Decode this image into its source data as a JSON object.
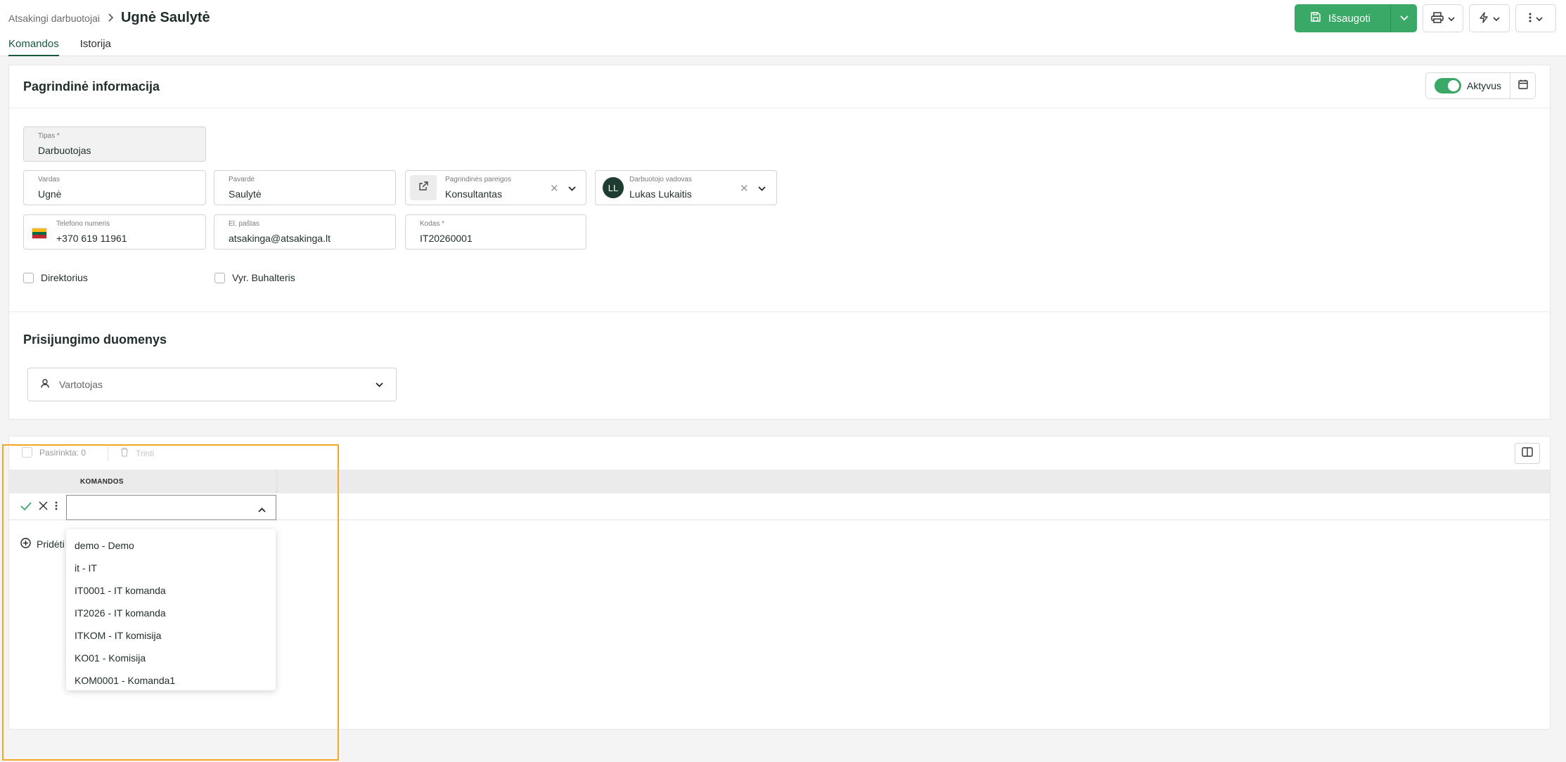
{
  "header": {
    "breadcrumb_parent": "Atsakingi darbuotojai",
    "title": "Ugnė Saulytė",
    "tabs": [
      {
        "label": "Komandos",
        "active": true
      },
      {
        "label": "Istorija",
        "active": false
      }
    ],
    "save_label": "Išsaugoti",
    "accent_color": "#3aa866"
  },
  "basic": {
    "section_title": "Pagrindinė informacija",
    "status_label": "Aktyvus",
    "status_active": true,
    "fields": {
      "type": {
        "label": "Tipas *",
        "value": "Darbuotojas"
      },
      "first_name": {
        "label": "Vardas",
        "value": "Ugnė"
      },
      "last_name": {
        "label": "Pavardė",
        "value": "Saulytė"
      },
      "position": {
        "label": "Pagrindinės pareigos",
        "value": "Konsultantas"
      },
      "manager": {
        "label": "Darbuotojo vadovas",
        "value": "Lukas Lukaitis",
        "initials": "LL"
      },
      "phone": {
        "label": "Telefono numeris",
        "value": "+370 619 11961"
      },
      "email": {
        "label": "El. paštas",
        "value": "atsakinga@atsakinga.lt"
      },
      "code": {
        "label": "Kodas *",
        "value": "IT20260001"
      }
    },
    "checkboxes": {
      "director": "Direktorius",
      "chief_accountant": "Vyr. Buhalteris"
    }
  },
  "login": {
    "section_title": "Prisijungimo duomenys",
    "user_placeholder": "Vartotojas"
  },
  "teams": {
    "selected_label": "Pasirinkta: 0",
    "delete_label": "Trinti",
    "column_header": "KOMANDOS",
    "add_label": "Pridėti",
    "options": [
      "demo - Demo",
      "it - IT",
      "IT0001 - IT komanda",
      "IT2026 - IT komanda",
      "ITKOM - IT komisija",
      "KO01 - Komisija",
      "KOM0001 - Komanda1"
    ]
  }
}
